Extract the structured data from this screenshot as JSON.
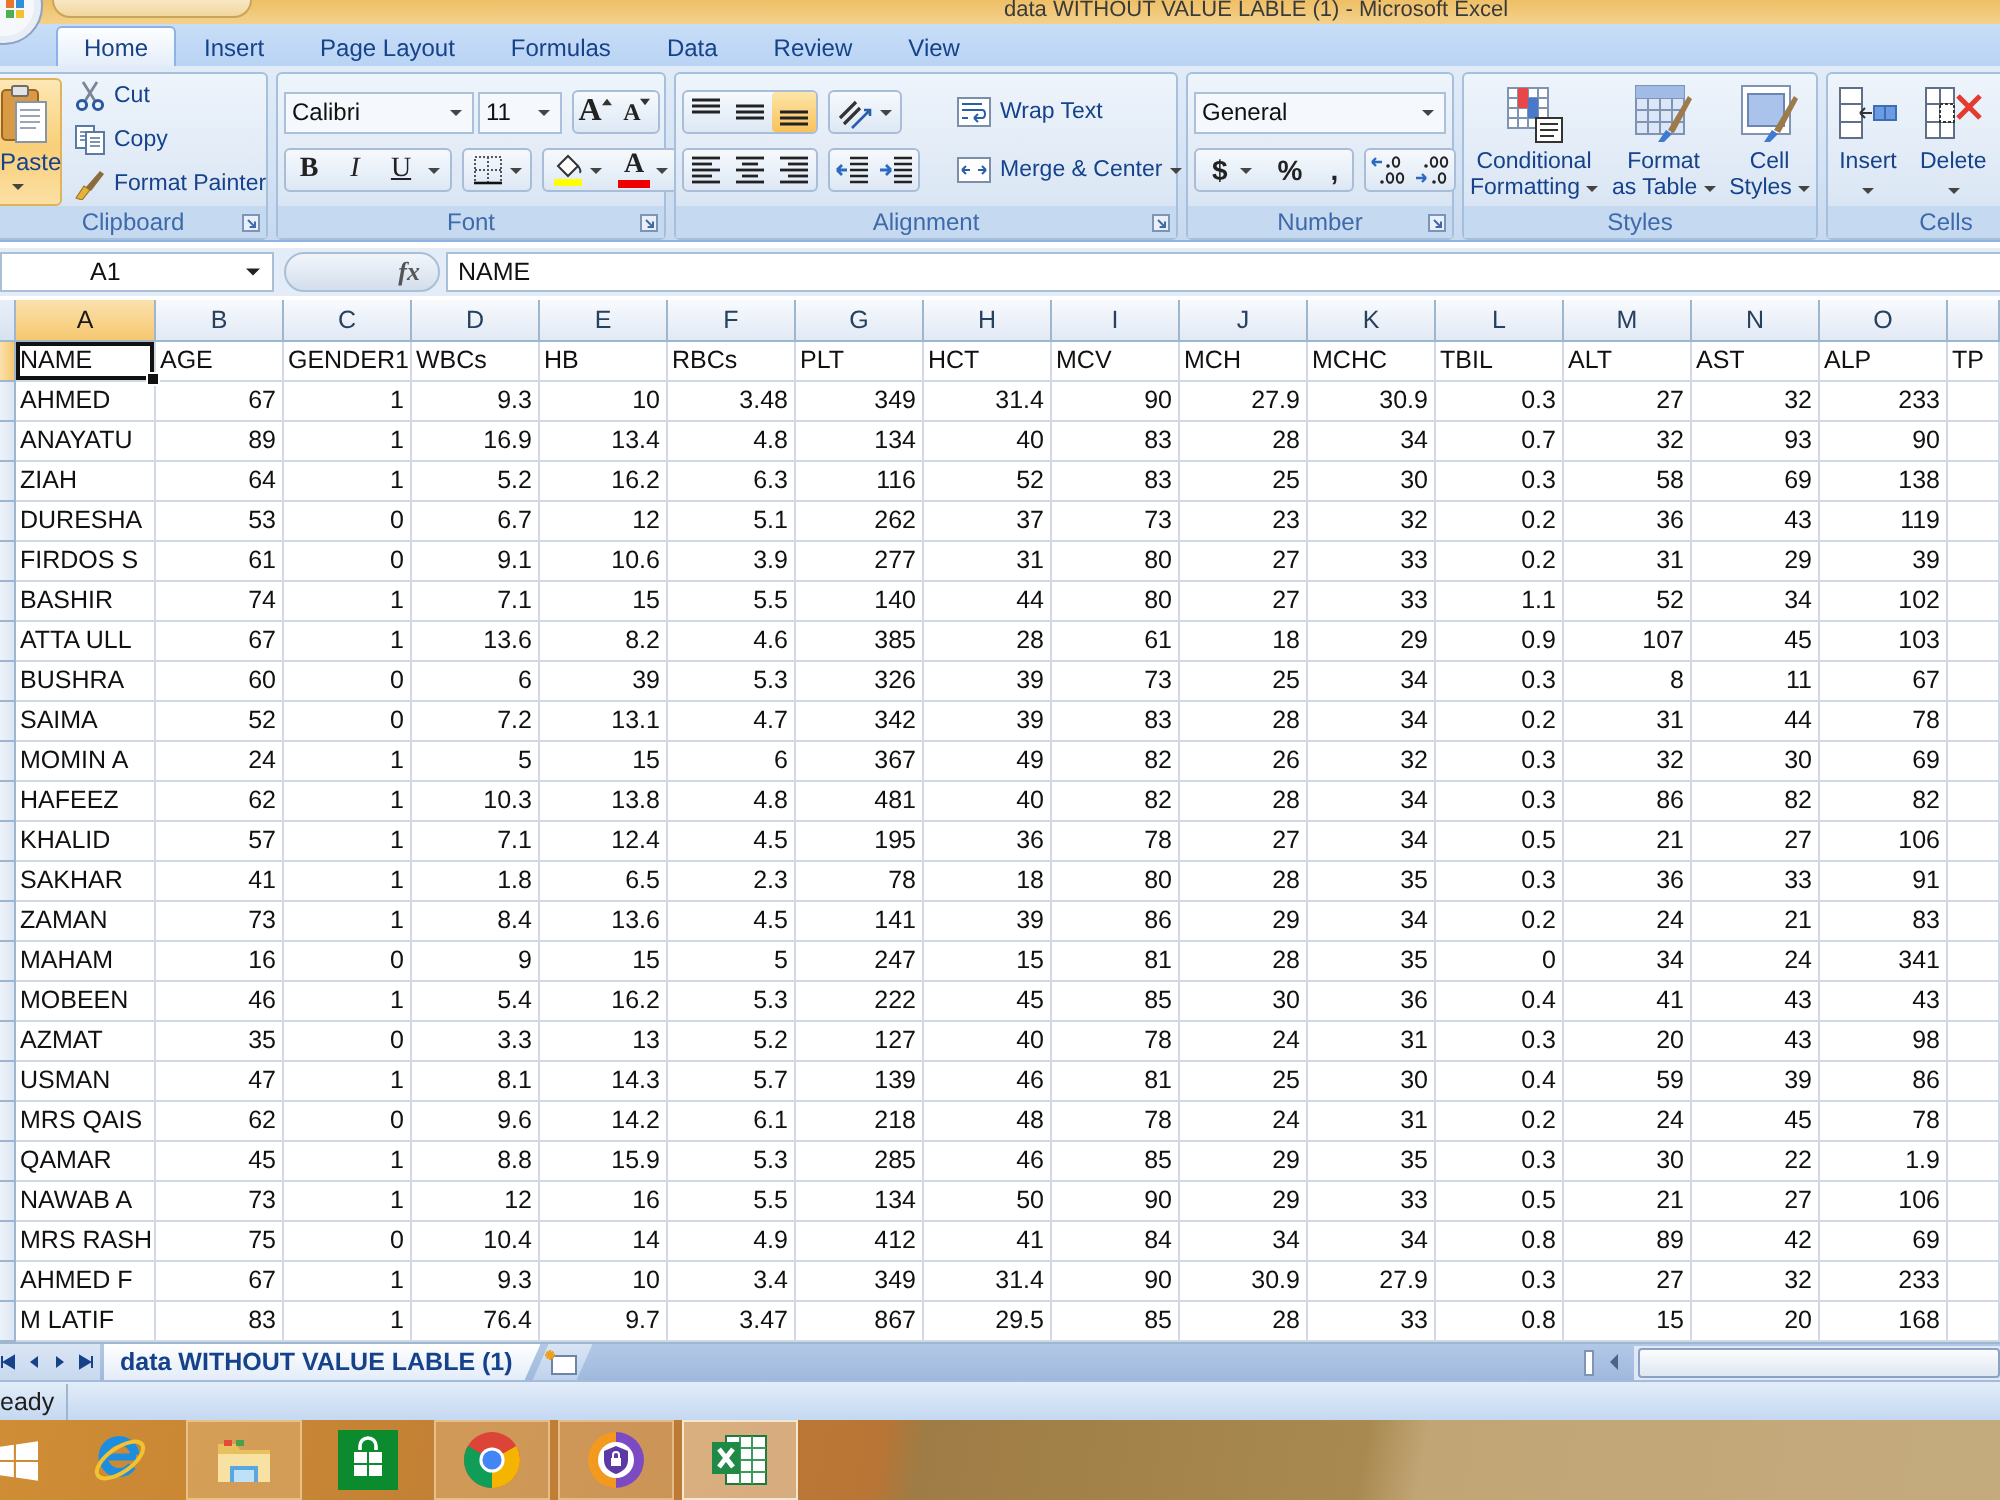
{
  "window": {
    "title": "data WITHOUT VALUE LABLE (1) - Microsoft Excel"
  },
  "tabs": [
    {
      "label": "Home",
      "selected": true
    },
    {
      "label": "Insert",
      "selected": false
    },
    {
      "label": "Page Layout",
      "selected": false
    },
    {
      "label": "Formulas",
      "selected": false
    },
    {
      "label": "Data",
      "selected": false
    },
    {
      "label": "Review",
      "selected": false
    },
    {
      "label": "View",
      "selected": false
    }
  ],
  "ribbon": {
    "clipboard": {
      "label": "Clipboard",
      "paste": "Paste",
      "commands": [
        {
          "kind": "cut",
          "label": "Cut"
        },
        {
          "kind": "copy",
          "label": "Copy"
        },
        {
          "kind": "format-painter",
          "label": "Format Painter"
        }
      ]
    },
    "font": {
      "label": "Font",
      "font_name": "Calibri",
      "font_size": "11",
      "grow": "A",
      "shrink": "A",
      "styles": [
        {
          "kind": "bold",
          "label": "B"
        },
        {
          "kind": "italic",
          "label": "I"
        },
        {
          "kind": "underline",
          "label": "U"
        }
      ],
      "font_color": "A"
    },
    "alignment": {
      "label": "Alignment",
      "vertical": [
        {
          "kind": "top",
          "selected": false
        },
        {
          "kind": "middle",
          "selected": false
        },
        {
          "kind": "bottom",
          "selected": true
        }
      ],
      "horizontal": [
        {
          "kind": "left",
          "selected": false
        },
        {
          "kind": "center",
          "selected": false
        },
        {
          "kind": "right",
          "selected": false
        }
      ],
      "wrap_text": "Wrap Text",
      "merge": "Merge & Center"
    },
    "number": {
      "label": "Number",
      "format": "General",
      "symbols": [
        "$",
        "%",
        ","
      ]
    },
    "styles": {
      "label": "Styles",
      "buttons": [
        {
          "kind": "conditional",
          "lines": [
            "Conditional",
            "Formatting"
          ]
        },
        {
          "kind": "table",
          "lines": [
            "Format",
            "as Table"
          ]
        },
        {
          "kind": "cell",
          "lines": [
            "Cell",
            "Styles"
          ]
        }
      ]
    },
    "cells": {
      "label": "Cells",
      "buttons": [
        {
          "kind": "insert",
          "label": "Insert"
        },
        {
          "kind": "delete",
          "label": "Delete"
        }
      ]
    }
  },
  "formula_bar": {
    "name_box": "A1",
    "function_label": "fx",
    "formula": "NAME"
  },
  "sheet": {
    "columns": [
      {
        "letter": "A",
        "selected": true
      },
      {
        "letter": "B",
        "selected": false
      },
      {
        "letter": "C",
        "selected": false
      },
      {
        "letter": "D",
        "selected": false
      },
      {
        "letter": "E",
        "selected": false
      },
      {
        "letter": "F",
        "selected": false
      },
      {
        "letter": "G",
        "selected": false
      },
      {
        "letter": "H",
        "selected": false
      },
      {
        "letter": "I",
        "selected": false
      },
      {
        "letter": "J",
        "selected": false
      },
      {
        "letter": "K",
        "selected": false
      },
      {
        "letter": "L",
        "selected": false
      },
      {
        "letter": "M",
        "selected": false
      },
      {
        "letter": "N",
        "selected": false
      },
      {
        "letter": "O",
        "selected": false
      }
    ],
    "rows": [
      {
        "kind": "header",
        "selected": true,
        "cells": [
          "NAME",
          "AGE",
          "GENDER1",
          "WBCs",
          "HB",
          "RBCs",
          "PLT",
          "HCT",
          "MCV",
          "MCH",
          "MCHC",
          "TBIL",
          "ALT",
          "AST",
          "ALP",
          "TP"
        ]
      },
      {
        "kind": "data",
        "selected": false,
        "cells": [
          "AHMED",
          "67",
          "1",
          "9.3",
          "10",
          "3.48",
          "349",
          "31.4",
          "90",
          "27.9",
          "30.9",
          "0.3",
          "27",
          "32",
          "233"
        ]
      },
      {
        "kind": "data",
        "selected": false,
        "cells": [
          "ANAYATU",
          "89",
          "1",
          "16.9",
          "13.4",
          "4.8",
          "134",
          "40",
          "83",
          "28",
          "34",
          "0.7",
          "32",
          "93",
          "90"
        ]
      },
      {
        "kind": "data",
        "selected": false,
        "cells": [
          "ZIAH",
          "64",
          "1",
          "5.2",
          "16.2",
          "6.3",
          "116",
          "52",
          "83",
          "25",
          "30",
          "0.3",
          "58",
          "69",
          "138"
        ]
      },
      {
        "kind": "data",
        "selected": false,
        "cells": [
          "DURESHA",
          "53",
          "0",
          "6.7",
          "12",
          "5.1",
          "262",
          "37",
          "73",
          "23",
          "32",
          "0.2",
          "36",
          "43",
          "119"
        ]
      },
      {
        "kind": "data",
        "selected": false,
        "cells": [
          "FIRDOS S",
          "61",
          "0",
          "9.1",
          "10.6",
          "3.9",
          "277",
          "31",
          "80",
          "27",
          "33",
          "0.2",
          "31",
          "29",
          "39"
        ]
      },
      {
        "kind": "data",
        "selected": false,
        "cells": [
          "BASHIR",
          "74",
          "1",
          "7.1",
          "15",
          "5.5",
          "140",
          "44",
          "80",
          "27",
          "33",
          "1.1",
          "52",
          "34",
          "102"
        ]
      },
      {
        "kind": "data",
        "selected": false,
        "cells": [
          "ATTA ULL",
          "67",
          "1",
          "13.6",
          "8.2",
          "4.6",
          "385",
          "28",
          "61",
          "18",
          "29",
          "0.9",
          "107",
          "45",
          "103"
        ]
      },
      {
        "kind": "data",
        "selected": false,
        "cells": [
          "BUSHRA",
          "60",
          "0",
          "6",
          "39",
          "5.3",
          "326",
          "39",
          "73",
          "25",
          "34",
          "0.3",
          "8",
          "11",
          "67"
        ]
      },
      {
        "kind": "data",
        "selected": false,
        "cells": [
          "SAIMA",
          "52",
          "0",
          "7.2",
          "13.1",
          "4.7",
          "342",
          "39",
          "83",
          "28",
          "34",
          "0.2",
          "31",
          "44",
          "78"
        ]
      },
      {
        "kind": "data",
        "selected": false,
        "cells": [
          "MOMIN A",
          "24",
          "1",
          "5",
          "15",
          "6",
          "367",
          "49",
          "82",
          "26",
          "32",
          "0.3",
          "32",
          "30",
          "69"
        ]
      },
      {
        "kind": "data",
        "selected": false,
        "cells": [
          "HAFEEZ",
          "62",
          "1",
          "10.3",
          "13.8",
          "4.8",
          "481",
          "40",
          "82",
          "28",
          "34",
          "0.3",
          "86",
          "82",
          "82"
        ]
      },
      {
        "kind": "data",
        "selected": false,
        "cells": [
          "KHALID",
          "57",
          "1",
          "7.1",
          "12.4",
          "4.5",
          "195",
          "36",
          "78",
          "27",
          "34",
          "0.5",
          "21",
          "27",
          "106"
        ]
      },
      {
        "kind": "data",
        "selected": false,
        "cells": [
          "SAKHAR",
          "41",
          "1",
          "1.8",
          "6.5",
          "2.3",
          "78",
          "18",
          "80",
          "28",
          "35",
          "0.3",
          "36",
          "33",
          "91"
        ]
      },
      {
        "kind": "data",
        "selected": false,
        "cells": [
          "ZAMAN",
          "73",
          "1",
          "8.4",
          "13.6",
          "4.5",
          "141",
          "39",
          "86",
          "29",
          "34",
          "0.2",
          "24",
          "21",
          "83"
        ]
      },
      {
        "kind": "data",
        "selected": false,
        "cells": [
          "MAHAM",
          "16",
          "0",
          "9",
          "15",
          "5",
          "247",
          "15",
          "81",
          "28",
          "35",
          "0",
          "34",
          "24",
          "341"
        ]
      },
      {
        "kind": "data",
        "selected": false,
        "cells": [
          "MOBEEN",
          "46",
          "1",
          "5.4",
          "16.2",
          "5.3",
          "222",
          "45",
          "85",
          "30",
          "36",
          "0.4",
          "41",
          "43",
          "43"
        ]
      },
      {
        "kind": "data",
        "selected": false,
        "cells": [
          "AZMAT",
          "35",
          "0",
          "3.3",
          "13",
          "5.2",
          "127",
          "40",
          "78",
          "24",
          "31",
          "0.3",
          "20",
          "43",
          "98"
        ]
      },
      {
        "kind": "data",
        "selected": false,
        "cells": [
          "USMAN",
          "47",
          "1",
          "8.1",
          "14.3",
          "5.7",
          "139",
          "46",
          "81",
          "25",
          "30",
          "0.4",
          "59",
          "39",
          "86"
        ]
      },
      {
        "kind": "data",
        "selected": false,
        "cells": [
          "MRS QAIS",
          "62",
          "0",
          "9.6",
          "14.2",
          "6.1",
          "218",
          "48",
          "78",
          "24",
          "31",
          "0.2",
          "24",
          "45",
          "78"
        ]
      },
      {
        "kind": "data",
        "selected": false,
        "cells": [
          "QAMAR",
          "45",
          "1",
          "8.8",
          "15.9",
          "5.3",
          "285",
          "46",
          "85",
          "29",
          "35",
          "0.3",
          "30",
          "22",
          "1.9"
        ]
      },
      {
        "kind": "data",
        "selected": false,
        "cells": [
          "NAWAB A",
          "73",
          "1",
          "12",
          "16",
          "5.5",
          "134",
          "50",
          "90",
          "29",
          "33",
          "0.5",
          "21",
          "27",
          "106"
        ]
      },
      {
        "kind": "data",
        "selected": false,
        "cells": [
          "MRS RASH",
          "75",
          "0",
          "10.4",
          "14",
          "4.9",
          "412",
          "41",
          "84",
          "34",
          "34",
          "0.8",
          "89",
          "42",
          "69"
        ]
      },
      {
        "kind": "data",
        "selected": false,
        "cells": [
          "AHMED F",
          "67",
          "1",
          "9.3",
          "10",
          "3.4",
          "349",
          "31.4",
          "90",
          "30.9",
          "27.9",
          "0.3",
          "27",
          "32",
          "233"
        ]
      },
      {
        "kind": "data",
        "selected": false,
        "cells": [
          "M LATIF",
          "83",
          "1",
          "76.4",
          "9.7",
          "3.47",
          "867",
          "29.5",
          "85",
          "28",
          "33",
          "0.8",
          "15",
          "20",
          "168"
        ]
      }
    ]
  },
  "sheet_tabs": [
    {
      "label": "data WITHOUT VALUE LABLE (1)",
      "selected": true
    }
  ],
  "status_bar": {
    "text": "eady"
  },
  "taskbar": {
    "items": [
      {
        "kind": "e-logo",
        "running": false,
        "selected": false
      },
      {
        "kind": "folder",
        "running": true,
        "selected": false
      },
      {
        "kind": "store",
        "running": false,
        "selected": false
      },
      {
        "kind": "round-browser",
        "running": true,
        "selected": false
      },
      {
        "kind": "shield",
        "running": true,
        "selected": false
      },
      {
        "kind": "spreadsheet",
        "running": true,
        "selected": true
      }
    ]
  }
}
